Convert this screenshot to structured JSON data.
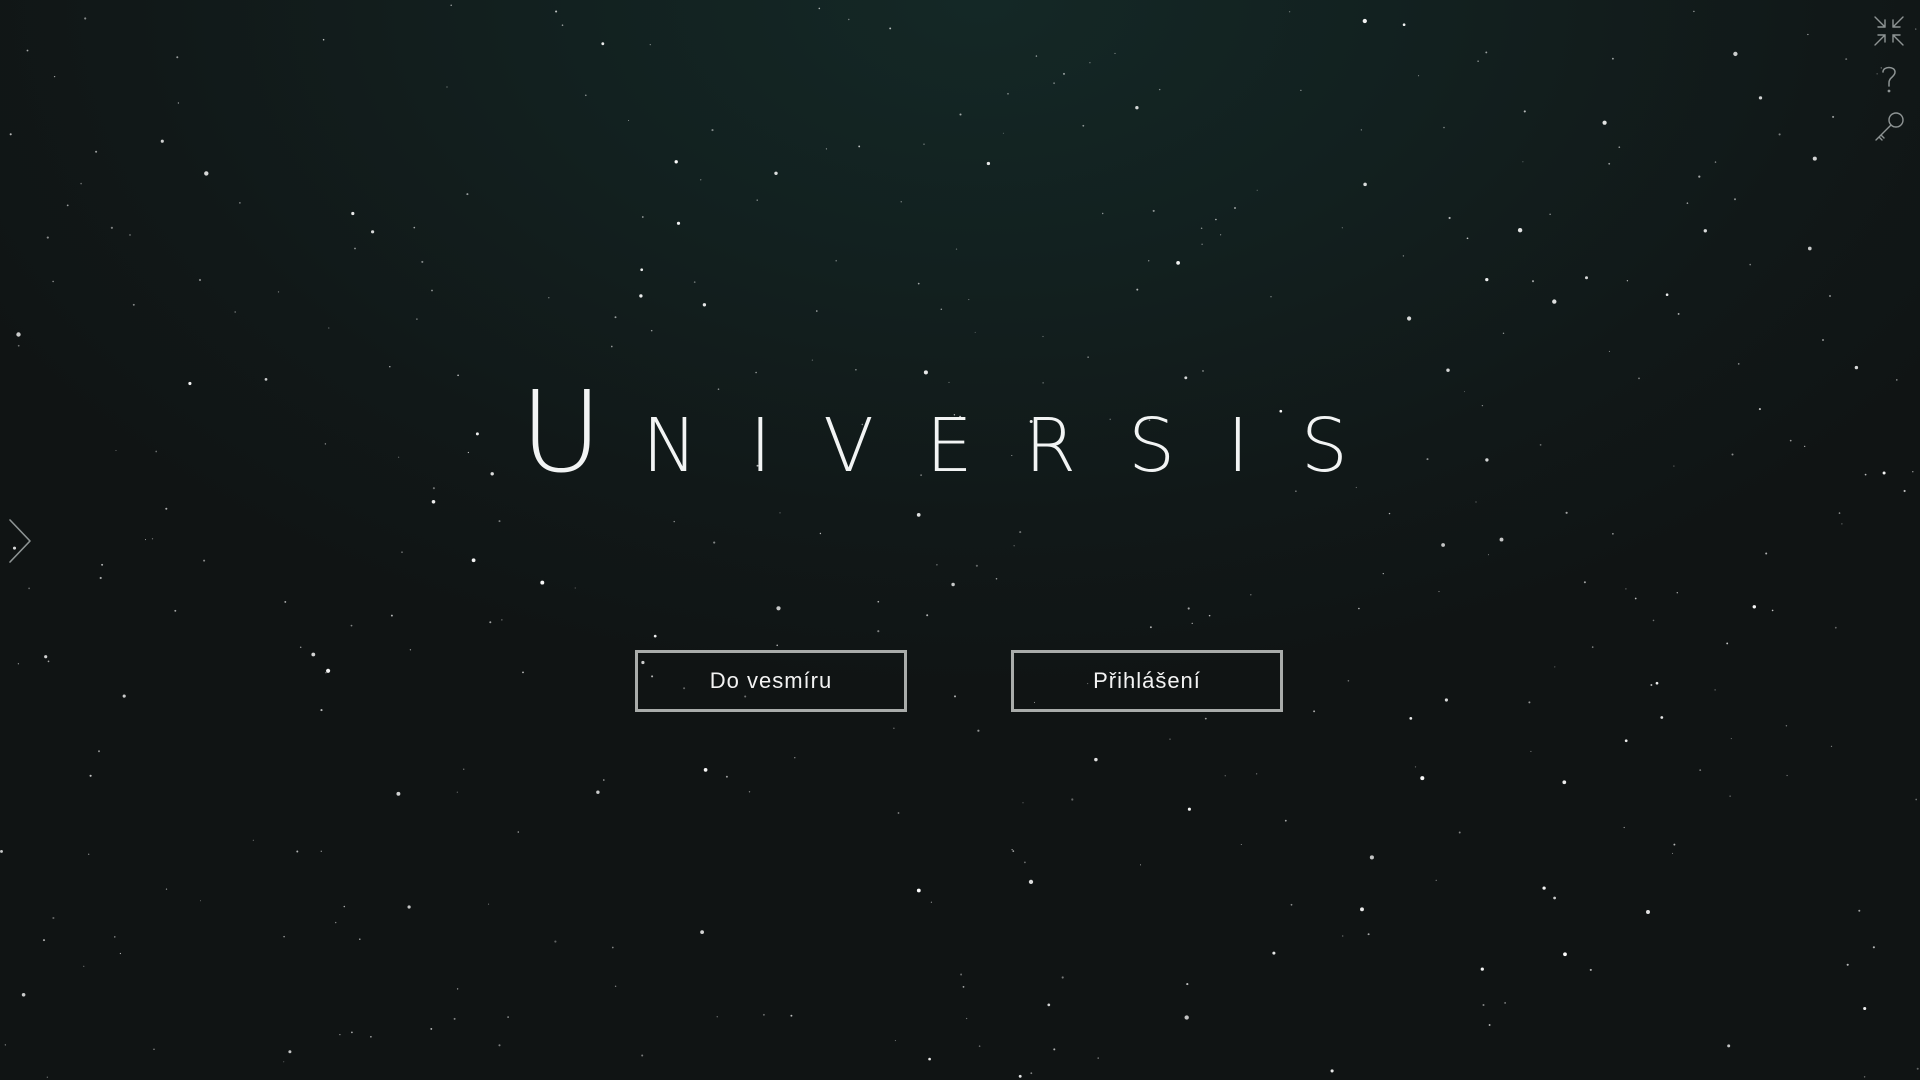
{
  "logo": {
    "first_letter": "U",
    "rest": "NIVERSIS"
  },
  "buttons": {
    "universe_label": "Do vesmíru",
    "login_label": "Přihlášení"
  },
  "icons": {
    "top_right": [
      "collapse-icon",
      "help-icon",
      "key-icon"
    ],
    "left": "chevron-right-icon"
  },
  "colors": {
    "background": "#101515",
    "text": "#f2f4f4",
    "button_border": "#a9acaa",
    "icon": "#8e9494"
  }
}
